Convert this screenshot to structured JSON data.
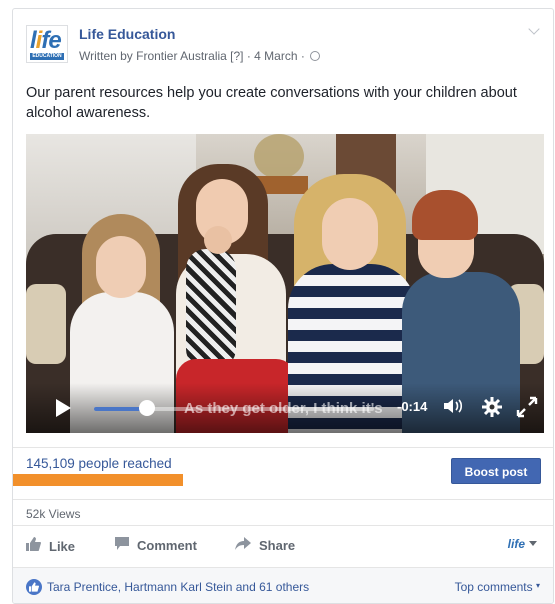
{
  "post": {
    "page_name": "Life Education",
    "author_line": "Written by Frontier Australia [?] · 4 March ·",
    "logo_text": "life",
    "logo_subtext": "EDUCATION",
    "text": "Our parent resources help you create conversations with your children about alcohol awareness."
  },
  "video": {
    "caption": "As they get older, I think it's",
    "time_remaining": "-0:14",
    "progress_fraction": 0.19,
    "icons": [
      "play-icon",
      "volume-icon",
      "settings-icon",
      "fullscreen-icon"
    ]
  },
  "insights": {
    "reach_text": "145,109 people reached",
    "boost_label": "Boost post",
    "views_text": "52k Views"
  },
  "actions": {
    "like_label": "Like",
    "comment_label": "Comment",
    "share_label": "Share",
    "page_selector_label": "life"
  },
  "footer": {
    "likers_text": "Tara Prentice, Hartmann Karl Stein and 61 others",
    "top_comments_label": "Top comments"
  },
  "colors": {
    "link_blue": "#365899",
    "boost_blue": "#4267b2",
    "reach_highlight": "#f2902b"
  }
}
